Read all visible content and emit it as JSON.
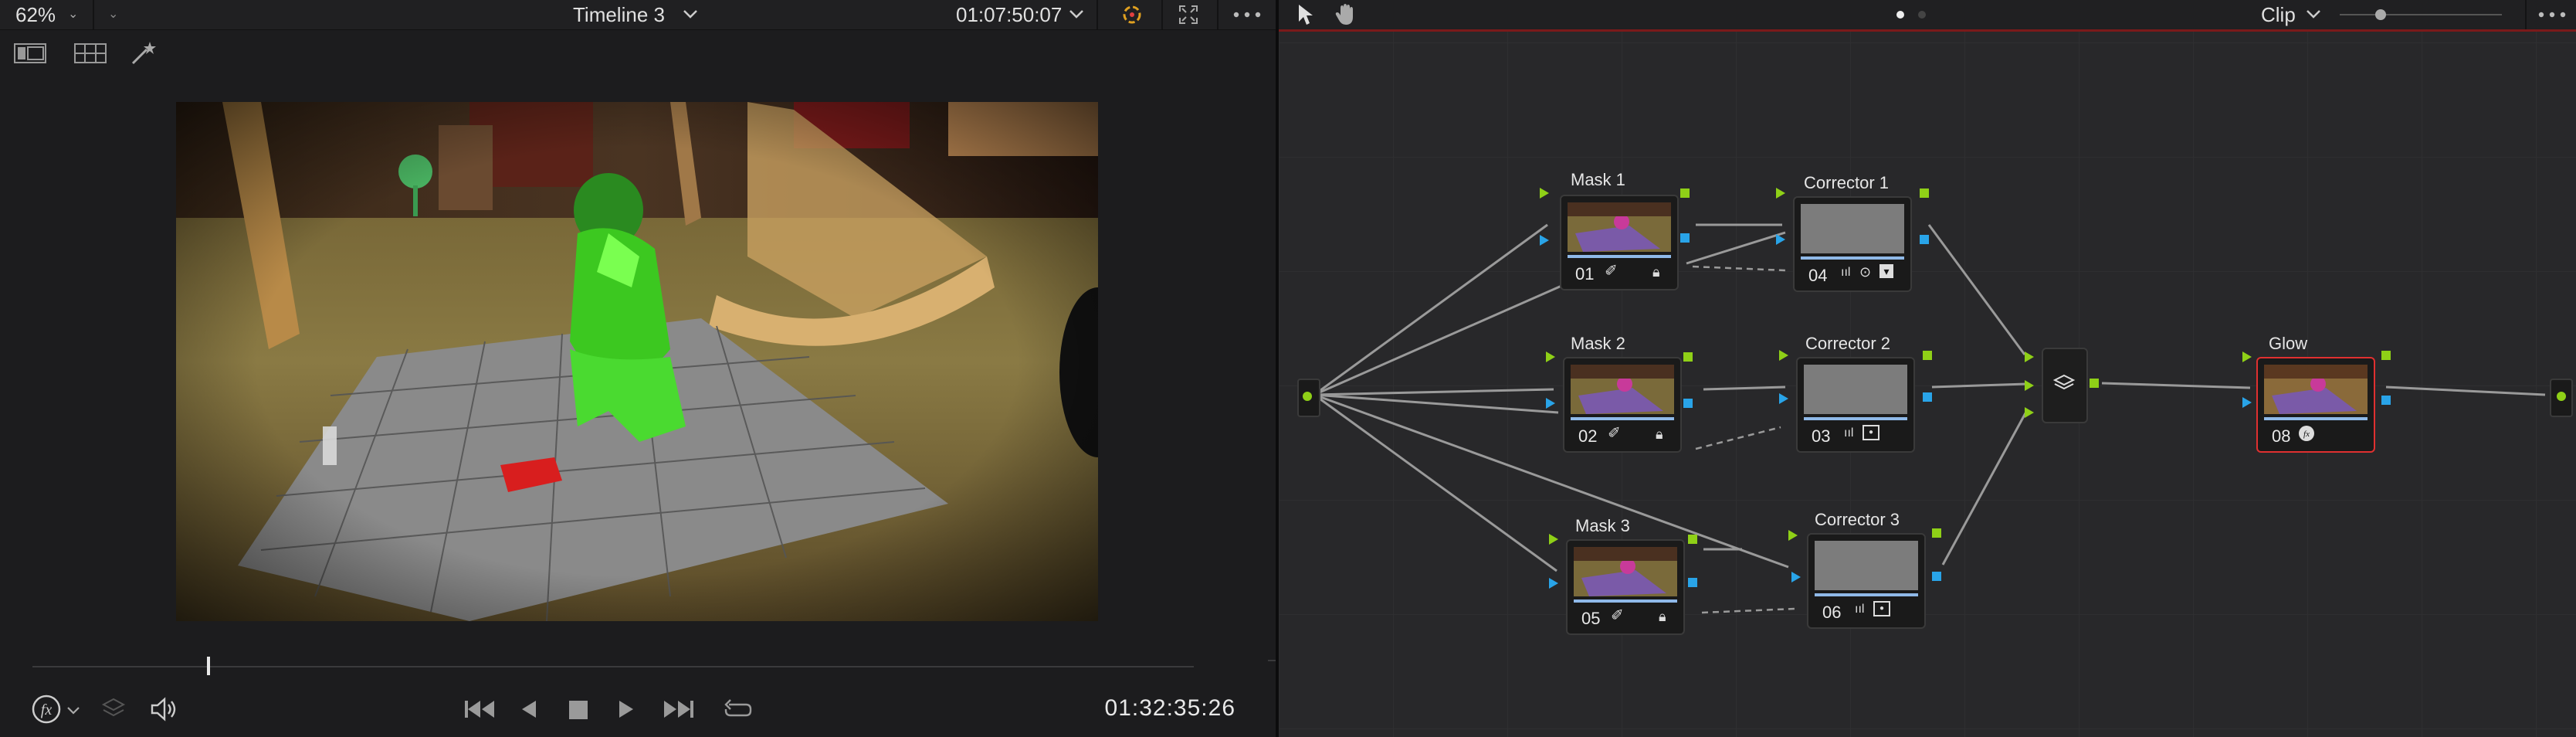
{
  "viewer": {
    "zoom": "62%",
    "timeline_name": "Timeline 3",
    "source_timecode": "01:07:50:07",
    "record_timecode": "01:32:35:26",
    "scrubber_position": 0.15
  },
  "node_editor": {
    "mode": "Clip",
    "nodes": [
      {
        "label": "Mask 1",
        "number": "01"
      },
      {
        "label": "Corrector 1",
        "number": "04"
      },
      {
        "label": "Mask 2",
        "number": "02"
      },
      {
        "label": "Corrector 2",
        "number": "03"
      },
      {
        "label": "Mask 3",
        "number": "05"
      },
      {
        "label": "Corrector 3",
        "number": "06"
      },
      {
        "label": "Glow",
        "number": "08"
      }
    ]
  },
  "colors": {
    "rgb_port": "#8fd017",
    "alpha_port": "#29a4e8",
    "selected_node": "#e03030"
  }
}
